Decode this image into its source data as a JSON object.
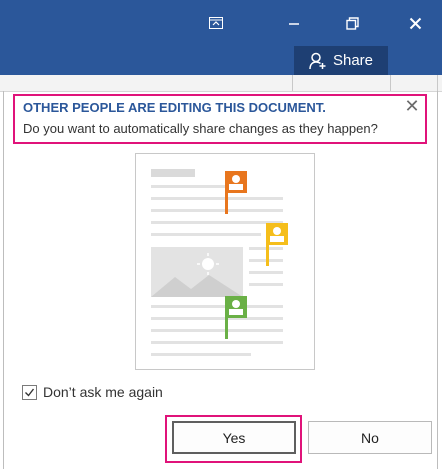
{
  "window": {
    "controls": [
      "ribbon-display-icon",
      "minimize-icon",
      "restore-icon",
      "close-icon"
    ]
  },
  "share": {
    "label": "Share",
    "icon": "person-add-icon"
  },
  "notification": {
    "title": "OTHER PEOPLE ARE EDITING THIS DOCUMENT.",
    "message": "Do you want to automatically share changes as they happen?",
    "close_label": "✕"
  },
  "illustration": {
    "icon": "document-with-coauthors-icon"
  },
  "options": {
    "dont_ask_label": "Don’t ask me again",
    "dont_ask_checked": true
  },
  "buttons": {
    "yes_label": "Yes",
    "no_label": "No"
  },
  "colors": {
    "titlebar": "#2b579a",
    "highlight": "#e0137a",
    "author_orange": "#e8761e",
    "author_yellow": "#f5be1b",
    "author_green": "#6ab046"
  }
}
